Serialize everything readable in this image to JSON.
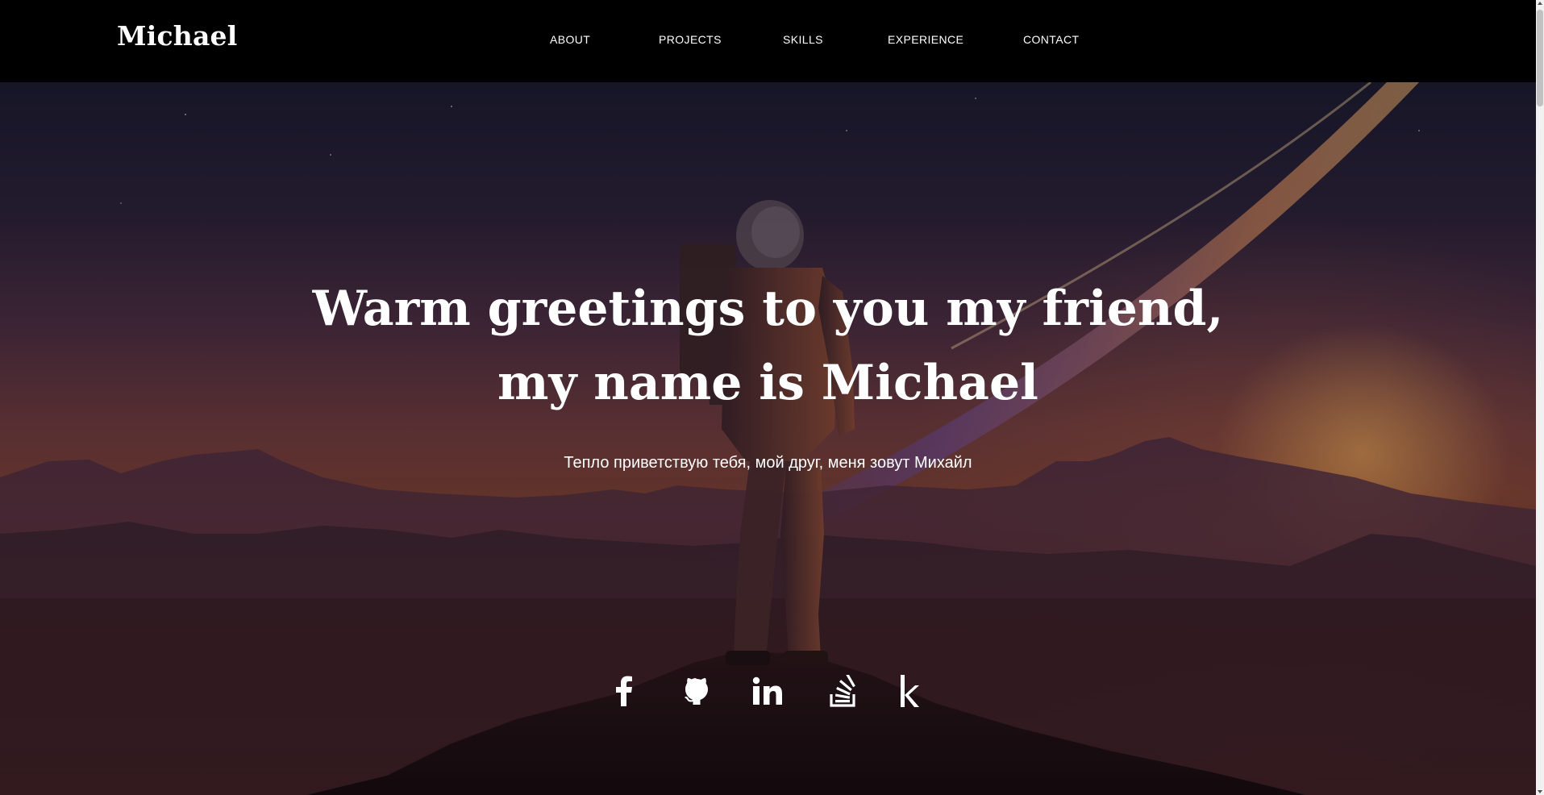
{
  "navbar": {
    "logo": "Michael",
    "links": [
      {
        "label": "ABOUT"
      },
      {
        "label": "PROJECTS"
      },
      {
        "label": "SKILLS"
      },
      {
        "label": "EXPERIENCE"
      },
      {
        "label": "CONTACT"
      }
    ]
  },
  "hero": {
    "title_line1": "Warm greetings to you my friend,",
    "title_line2": "my name is Michael",
    "subtitle": "Тепло приветствую тебя, мой друг, меня зовут Михайл",
    "background_image": "astronaut-on-mountain-peak-at-sunset"
  },
  "socials": [
    {
      "icon": "facebook-icon"
    },
    {
      "icon": "github-icon"
    },
    {
      "icon": "linkedin-icon"
    },
    {
      "icon": "stackoverflow-icon"
    },
    {
      "icon": "kaggle-icon"
    }
  ],
  "colors": {
    "navbar_bg": "#000000",
    "text": "#ffffff"
  }
}
